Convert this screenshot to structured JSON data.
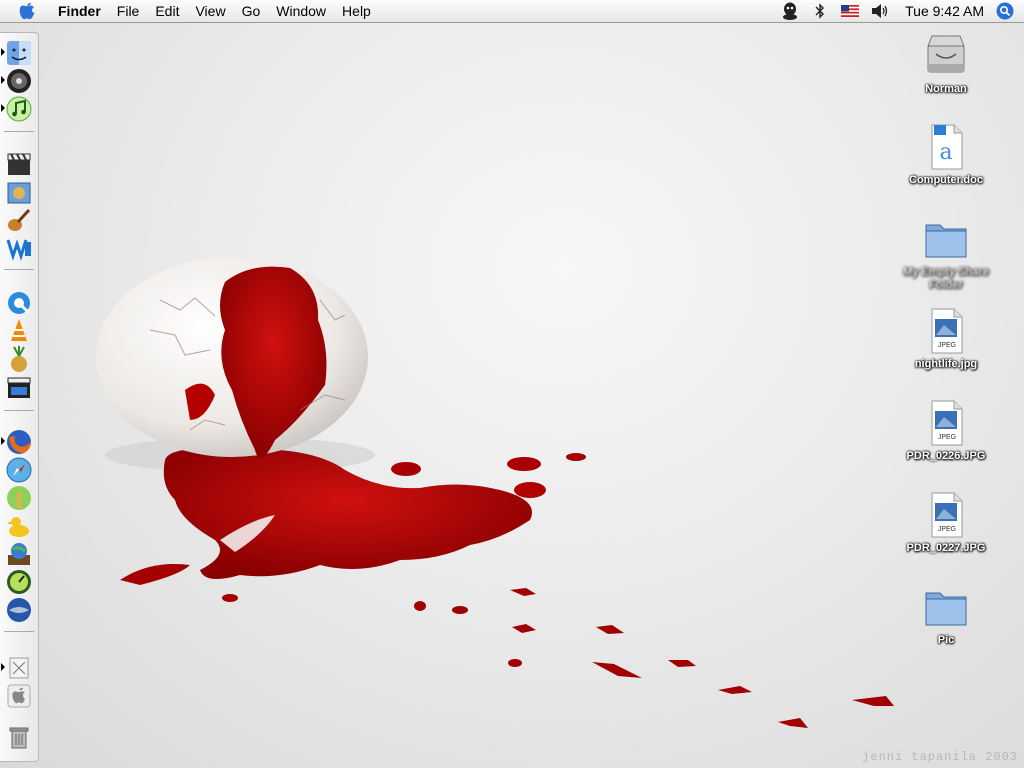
{
  "menubar": {
    "app_name": "Finder",
    "items": [
      "File",
      "Edit",
      "View",
      "Go",
      "Window",
      "Help"
    ],
    "clock": "Tue 9:42 AM",
    "status_icons": [
      "user-account-icon",
      "bluetooth-icon",
      "us-flag-input-menu-icon",
      "volume-icon"
    ]
  },
  "dock": {
    "icons": [
      "finder-icon",
      "dvd-player-icon",
      "itunes-icon",
      "imovie-icon",
      "iphoto-icon",
      "garageband-icon",
      "word-icon",
      "quicktime-icon",
      "vlc-icon",
      "pineapple-icon",
      "clapper-icon",
      "firefox-icon",
      "safari-icon",
      "giraffe-app-icon",
      "duck-app-icon",
      "globe-chart-icon",
      "dashboard-icon",
      "google-earth-icon",
      "documents-stack-icon",
      "apple-icon",
      "trash-icon"
    ]
  },
  "desktop": {
    "icons": [
      {
        "label": "Norman",
        "type": "hard-drive-icon"
      },
      {
        "label": "Computer.doc",
        "type": "word-document-icon"
      },
      {
        "label": "My Empty Share Folder",
        "type": "folder-icon"
      },
      {
        "label": "nightlife.jpg",
        "type": "jpeg-file-icon"
      },
      {
        "label": "PDR_0226.JPG",
        "type": "jpeg-file-icon"
      },
      {
        "label": "PDR_0227.JPG",
        "type": "jpeg-file-icon"
      },
      {
        "label": "Pic",
        "type": "folder-icon"
      }
    ]
  },
  "wallpaper": {
    "signature": "jenni tapanila 2003",
    "colors": {
      "blood": "#b00000",
      "shell": "#f4f1ee"
    }
  }
}
